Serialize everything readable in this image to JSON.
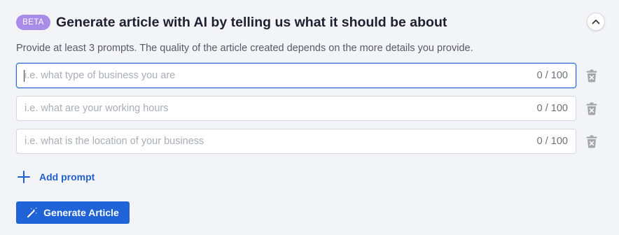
{
  "header": {
    "badge": "BETA",
    "title": "Generate article with AI by telling us what it should be about",
    "subtitle": "Provide at least 3 prompts. The quality of the article created depends on the more details you provide."
  },
  "prompts": [
    {
      "placeholder": "i.e. what type of business you are",
      "value": "",
      "counter": "0 / 100"
    },
    {
      "placeholder": "i.e. what are your working hours",
      "value": "",
      "counter": "0 / 100"
    },
    {
      "placeholder": "i.e. what is the location of your business",
      "value": "",
      "counter": "0 / 100"
    }
  ],
  "actions": {
    "add_prompt": "Add prompt",
    "generate": "Generate Article"
  },
  "icons": {
    "collapse": "chevron-up-icon",
    "delete": "trash-icon",
    "add": "plus-icon",
    "generate": "magic-wand-icon"
  },
  "colors": {
    "accent": "#1f63d6",
    "badge": "#a98be8",
    "focus_border": "#2c6ad8"
  }
}
